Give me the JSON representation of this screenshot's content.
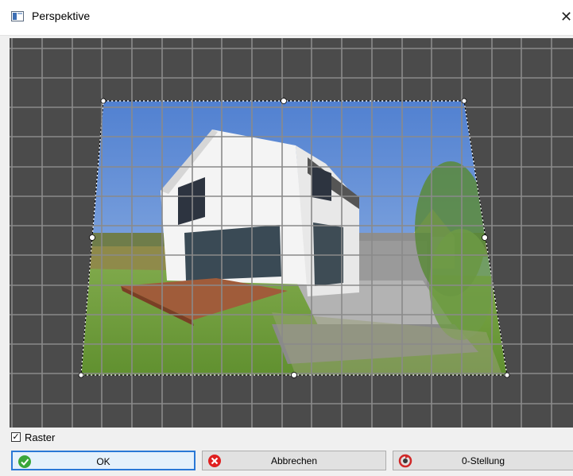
{
  "window": {
    "title": "Perspektive",
    "icon": "window-icon",
    "close_glyph": "✕"
  },
  "canvas": {
    "background": "#4b4b4b",
    "grid_color": "#8a8a8a",
    "content": "perspective-warped house photo"
  },
  "raster": {
    "label": "Raster",
    "checked": true
  },
  "buttons": {
    "ok": {
      "label": "OK",
      "icon": "check-icon"
    },
    "cancel": {
      "label": "Abbrechen",
      "icon": "cancel-icon"
    },
    "reset": {
      "label": "0-Stellung",
      "icon": "reset-icon"
    }
  }
}
